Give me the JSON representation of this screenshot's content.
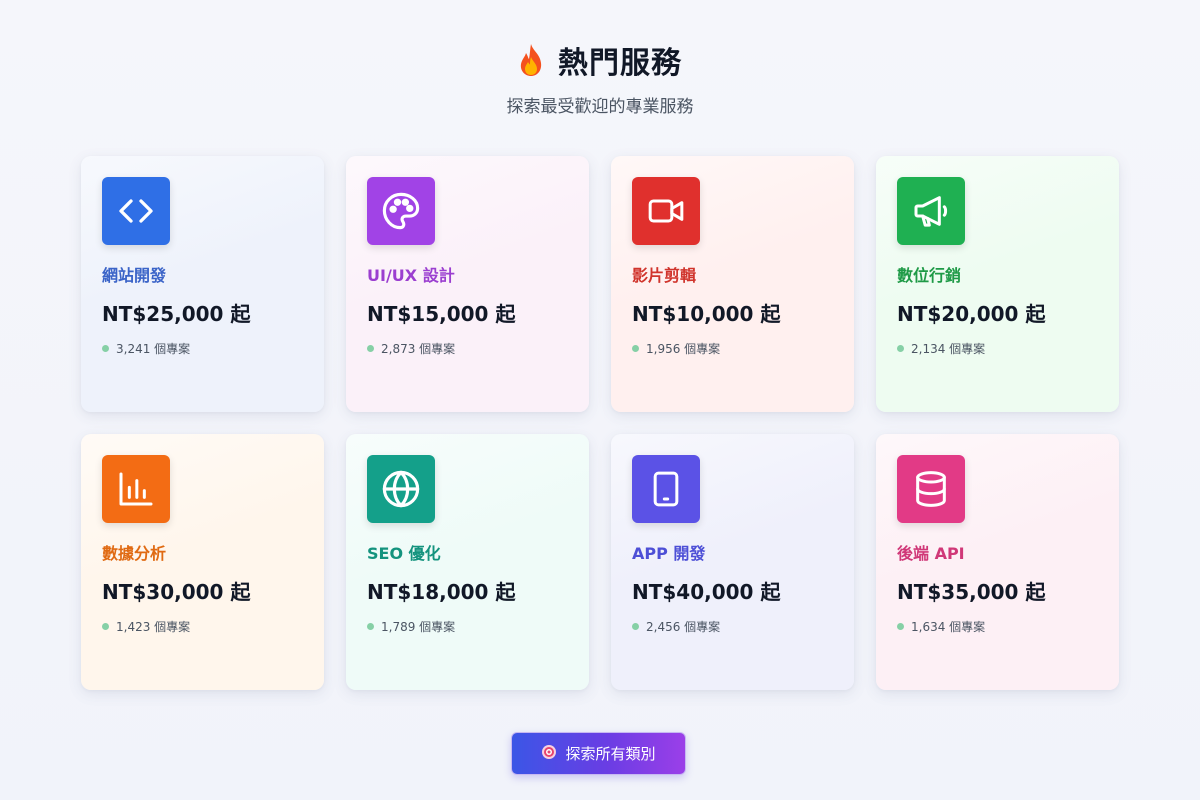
{
  "header": {
    "title": "熱門服務",
    "subtitle": "探索最受歡迎的專業服務",
    "icon": "fire-icon"
  },
  "colors": {
    "green_dot": "#86d0a6"
  },
  "cards": [
    {
      "name": "網站開發",
      "price": "NT$25,000 起",
      "count": "3,241 個專案",
      "icon": "code-icon",
      "accent": "#3b64c8",
      "icon_bg": "#2f6fe6",
      "card_bg": "#eef2fb"
    },
    {
      "name": "UI/UX 設計",
      "price": "NT$15,000 起",
      "count": "2,873 個專案",
      "icon": "palette-icon",
      "accent": "#9b3fd0",
      "icon_bg": "#a143e6",
      "card_bg": "#fbf1f9"
    },
    {
      "name": "影片剪輯",
      "price": "NT$10,000 起",
      "count": "1,956 個專案",
      "icon": "video-icon",
      "accent": "#d0342c",
      "icon_bg": "#e0302d",
      "card_bg": "#fff0ef"
    },
    {
      "name": "數位行銷",
      "price": "NT$20,000 起",
      "count": "2,134 個專案",
      "icon": "megaphone-icon",
      "accent": "#1f9a47",
      "icon_bg": "#1fb052",
      "card_bg": "#eefcf1"
    },
    {
      "name": "數據分析",
      "price": "NT$30,000 起",
      "count": "1,423 個專案",
      "icon": "bar-chart-icon",
      "accent": "#e06a12",
      "icon_bg": "#f36c14",
      "card_bg": "#fff6ec"
    },
    {
      "name": "SEO 優化",
      "price": "NT$18,000 起",
      "count": "1,789 個專案",
      "icon": "globe-icon",
      "accent": "#14937e",
      "icon_bg": "#14a08a",
      "card_bg": "#effbf8"
    },
    {
      "name": "APP 開發",
      "price": "NT$40,000 起",
      "count": "2,456 個專案",
      "icon": "tablet-icon",
      "accent": "#4d4fd6",
      "icon_bg": "#5b52e6",
      "card_bg": "#eff0fb"
    },
    {
      "name": "後端 API",
      "price": "NT$35,000 起",
      "count": "1,634 個專案",
      "icon": "database-icon",
      "accent": "#d03878",
      "icon_bg": "#e23a86",
      "card_bg": "#fdf0f5"
    }
  ],
  "cta": {
    "label": "探索所有類別",
    "icon": "target-icon"
  }
}
